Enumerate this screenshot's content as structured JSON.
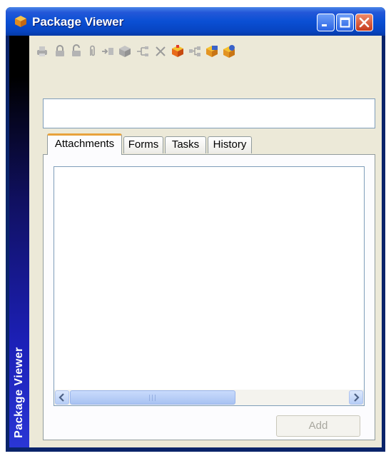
{
  "window": {
    "title": "Package Viewer"
  },
  "sidebar": {
    "label": "Package Viewer"
  },
  "toolbar": {
    "icons": [
      "print-icon",
      "lock-icon",
      "unlock-icon",
      "attach-icon",
      "import-icon",
      "package-icon",
      "workflow-icon",
      "delete-icon",
      "open-package-icon",
      "network-icon",
      "package-properties-icon",
      "package-help-icon"
    ]
  },
  "package_name": {
    "value": ""
  },
  "tabs": [
    {
      "label": "Attachments",
      "active": true
    },
    {
      "label": "Forms",
      "active": false
    },
    {
      "label": "Tasks",
      "active": false
    },
    {
      "label": "History",
      "active": false
    }
  ],
  "actions": {
    "add_label": "Add"
  },
  "colors": {
    "title_bar": "#0a4fd4",
    "window_bg": "#ece9d8",
    "tab_accent": "#e8a23c"
  }
}
